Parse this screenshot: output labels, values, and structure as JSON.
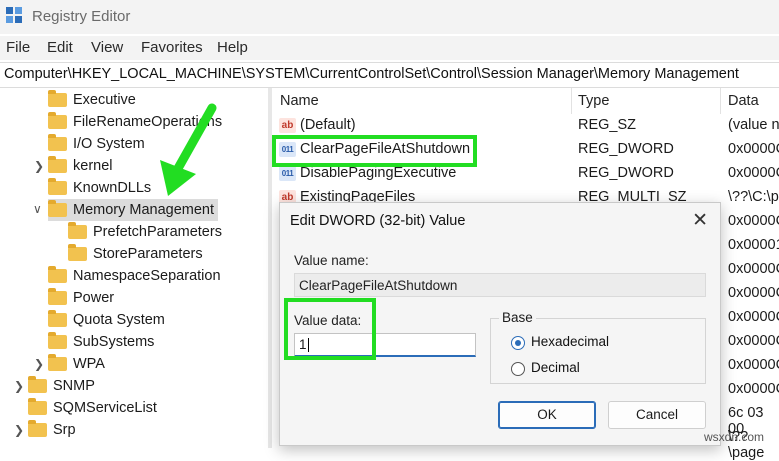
{
  "window": {
    "title": "Registry Editor"
  },
  "menu": [
    "File",
    "Edit",
    "View",
    "Favorites",
    "Help"
  ],
  "address": "Computer\\HKEY_LOCAL_MACHINE\\SYSTEM\\CurrentControlSet\\Control\\Session Manager\\Memory Management",
  "tree": [
    {
      "label": "Executive"
    },
    {
      "label": "FileRenameOperations"
    },
    {
      "label": "I/O System"
    },
    {
      "label": "kernel"
    },
    {
      "label": "KnownDLLs"
    },
    {
      "label": "Memory Management"
    },
    {
      "label": "PrefetchParameters"
    },
    {
      "label": "StoreParameters"
    },
    {
      "label": "NamespaceSeparation"
    },
    {
      "label": "Power"
    },
    {
      "label": "Quota System"
    },
    {
      "label": "SubSystems"
    },
    {
      "label": "WPA"
    },
    {
      "label": "SNMP"
    },
    {
      "label": "SQMServiceList"
    },
    {
      "label": "Srp"
    }
  ],
  "columns": {
    "name": "Name",
    "type": "Type",
    "data": "Data"
  },
  "rows": [
    {
      "name": "(Default)",
      "type": "REG_SZ",
      "data": "(value n",
      "icon": "ab"
    },
    {
      "name": "ClearPageFileAtShutdown",
      "type": "REG_DWORD",
      "data": "0x0000C",
      "icon": "binary"
    },
    {
      "name": "DisablePagingExecutive",
      "type": "REG_DWORD",
      "data": "0x0000C",
      "icon": "binary"
    },
    {
      "name": "ExistingPageFiles",
      "type": "REG_MULTI_SZ",
      "data": "\\??\\C:\\p",
      "icon": "ab"
    }
  ],
  "data_column_extra": [
    "0x0000C",
    "0x00001",
    "0x0000C",
    "0x0000C",
    "0x0000C",
    "0x0000C",
    "0x0000C",
    "0x0000C",
    "6c 03 00",
    "\\??\\page"
  ],
  "dialog": {
    "title": "Edit DWORD (32-bit) Value",
    "value_name_label": "Value name:",
    "value_name": "ClearPageFileAtShutdown",
    "value_data_label": "Value data:",
    "value_data": "1",
    "base_label": "Base",
    "hex_label": "Hexadecimal",
    "decimal_label": "Decimal",
    "base_selected": "Hexadecimal",
    "ok_label": "OK",
    "cancel_label": "Cancel"
  },
  "colors": {
    "highlight": "#22dd22",
    "accent": "#2b6cb8",
    "folder": "#f2c24f"
  },
  "watermark": "wsxdn.com"
}
